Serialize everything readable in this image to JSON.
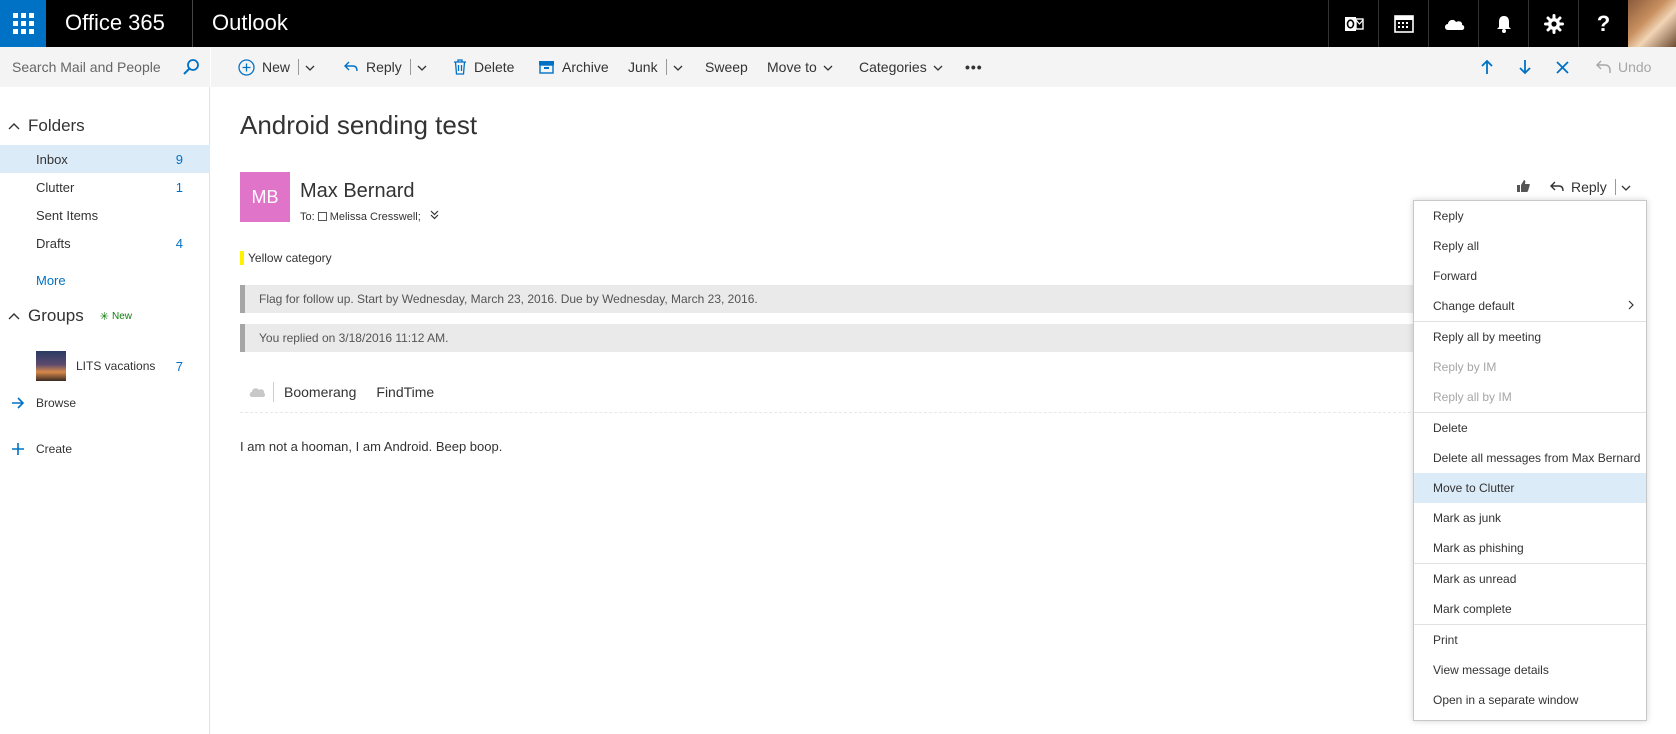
{
  "topbar": {
    "brand": "Office 365",
    "app": "Outlook",
    "icons": [
      "outlook-icon",
      "calendar-icon",
      "onedrive-icon",
      "bell-icon",
      "gear-icon",
      "help-icon"
    ],
    "help_label": "?"
  },
  "search": {
    "placeholder": "Search Mail and People"
  },
  "folders": {
    "header": "Folders",
    "items": [
      {
        "label": "Inbox",
        "count": "9"
      },
      {
        "label": "Clutter",
        "count": "1"
      },
      {
        "label": "Sent Items",
        "count": ""
      },
      {
        "label": "Drafts",
        "count": "4"
      }
    ],
    "more": "More"
  },
  "groups": {
    "header": "Groups",
    "badge": "New",
    "item": {
      "label": "LITS vacations",
      "count": "7"
    },
    "browse": "Browse",
    "create": "Create"
  },
  "toolbar": {
    "new": "New",
    "reply": "Reply",
    "delete": "Delete",
    "archive": "Archive",
    "junk": "Junk",
    "sweep": "Sweep",
    "move_to": "Move to",
    "categories": "Categories",
    "more": "•••",
    "undo": "Undo"
  },
  "message": {
    "subject": "Android sending test",
    "sender_initials": "MB",
    "sender_name": "Max Bernard",
    "to_label": "To:",
    "to_recipient": "Melissa Cresswell;",
    "category": "Yellow category",
    "flag_info": "Flag for follow up. Start by Wednesday, March 23, 2016. Due by Wednesday, March 23, 2016.",
    "replied_info": "You replied on 3/18/2016 11:12 AM.",
    "addins": [
      "Boomerang",
      "FindTime"
    ],
    "body": "I am not a hooman, I am Android. Beep boop.",
    "reply_label": "Reply"
  },
  "colors": {
    "accent": "#0072c6",
    "sender_avatar": "#e074c9",
    "category_yellow": "#fff100",
    "selected_bg": "#dcebf8",
    "new_badge": "#107c10"
  },
  "context_menu": {
    "items": [
      "Reply",
      "Reply all",
      "Forward",
      "Change default",
      "Reply all by meeting",
      "Reply by IM",
      "Reply all by IM",
      "Delete",
      "Delete all messages from Max Bernard",
      "Move to Clutter",
      "Mark as junk",
      "Mark as phishing",
      "Mark as unread",
      "Mark complete",
      "Print",
      "View message details",
      "Open in a separate window"
    ]
  }
}
